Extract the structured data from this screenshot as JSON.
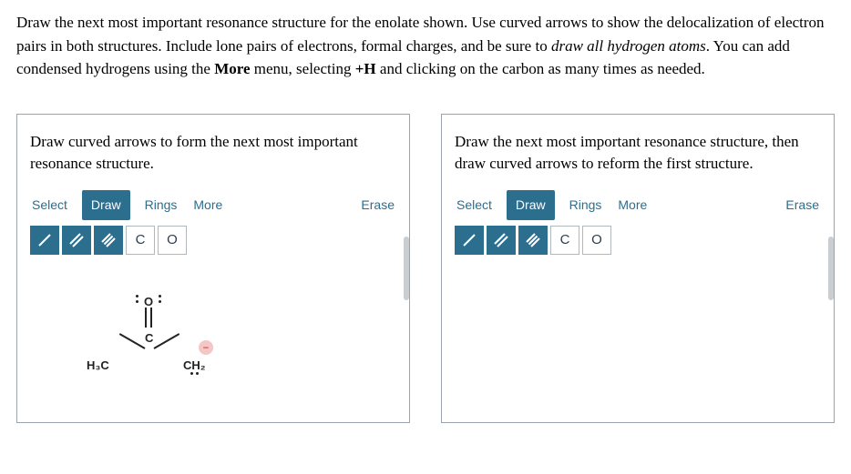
{
  "question": {
    "part1": "Draw the next most important resonance structure for the enolate shown. Use curved arrows to show the delocalization of electron pairs in both structures. Include lone pairs of electrons, formal charges, and be sure to ",
    "italic": "draw all hydrogen atoms",
    "part2": ". You can add condensed hydrogens using the ",
    "bold": "More",
    "part3": " menu, selecting ",
    "bold2": "+H",
    "part4": " and clicking on the carbon as many times as needed."
  },
  "left": {
    "prompt": "Draw curved arrows to form the next most important resonance structure.",
    "tabs": {
      "select": "Select",
      "draw": "Draw",
      "rings": "Rings",
      "more": "More"
    },
    "erase": "Erase",
    "atoms": {
      "c": "C",
      "o": "O"
    },
    "mol": {
      "o": "O",
      "c": "C",
      "h3c": "H₃C",
      "ch2": "CH₂",
      "minus": "−"
    }
  },
  "right": {
    "prompt": "Draw the next most important resonance structure, then draw curved arrows to reform the first structure.",
    "tabs": {
      "select": "Select",
      "draw": "Draw",
      "rings": "Rings",
      "more": "More"
    },
    "erase": "Erase",
    "atoms": {
      "c": "C",
      "o": "O"
    }
  }
}
